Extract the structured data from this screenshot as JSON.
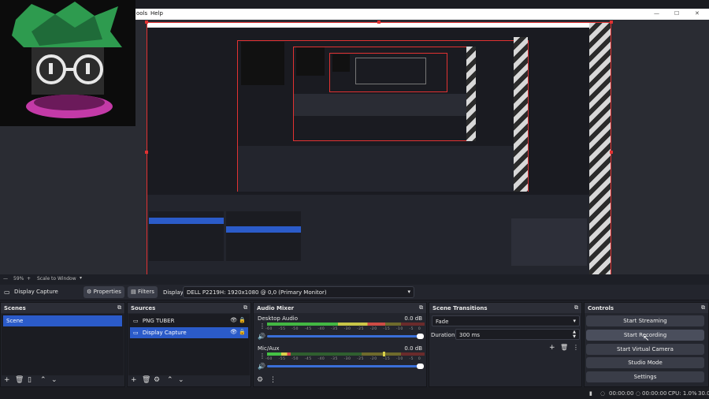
{
  "menubar": {
    "tools_fragment": "ools",
    "help": "Help"
  },
  "preview": {
    "zoom": "59%",
    "scale_mode": "Scale to Window"
  },
  "source_toolbar": {
    "source_name": "Display Capture",
    "properties_label": "Properties",
    "filters_label": "Filters",
    "display_label": "Display",
    "display_value": "DELL P2219H: 1920x1080 @ 0,0 (Primary Monitor)"
  },
  "scenes": {
    "title": "Scenes",
    "items": [
      "Scene"
    ]
  },
  "sources": {
    "title": "Sources",
    "items": [
      "PNG TUBER",
      "Display Capture"
    ]
  },
  "audio_mixer": {
    "title": "Audio Mixer",
    "channels": [
      {
        "name": "Desktop Audio",
        "level": "0.0 dB"
      },
      {
        "name": "Mic/Aux",
        "level": "0.0 dB"
      }
    ],
    "ticks": [
      "-60",
      "-55",
      "-50",
      "-45",
      "-40",
      "-35",
      "-30",
      "-25",
      "-20",
      "-15",
      "-10",
      "-5",
      "0"
    ]
  },
  "transitions": {
    "title": "Scene Transitions",
    "type": "Fade",
    "duration_label": "Duration",
    "duration_value": "300 ms"
  },
  "controls": {
    "title": "Controls",
    "buttons": [
      "Start Streaming",
      "Start Recording",
      "Start Virtual Camera",
      "Studio Mode",
      "Settings"
    ]
  },
  "status": {
    "stream_time": "00:00:00",
    "rec_time": "00:00:00",
    "cpu": "CPU: 1.0%",
    "fps": "30.0"
  }
}
